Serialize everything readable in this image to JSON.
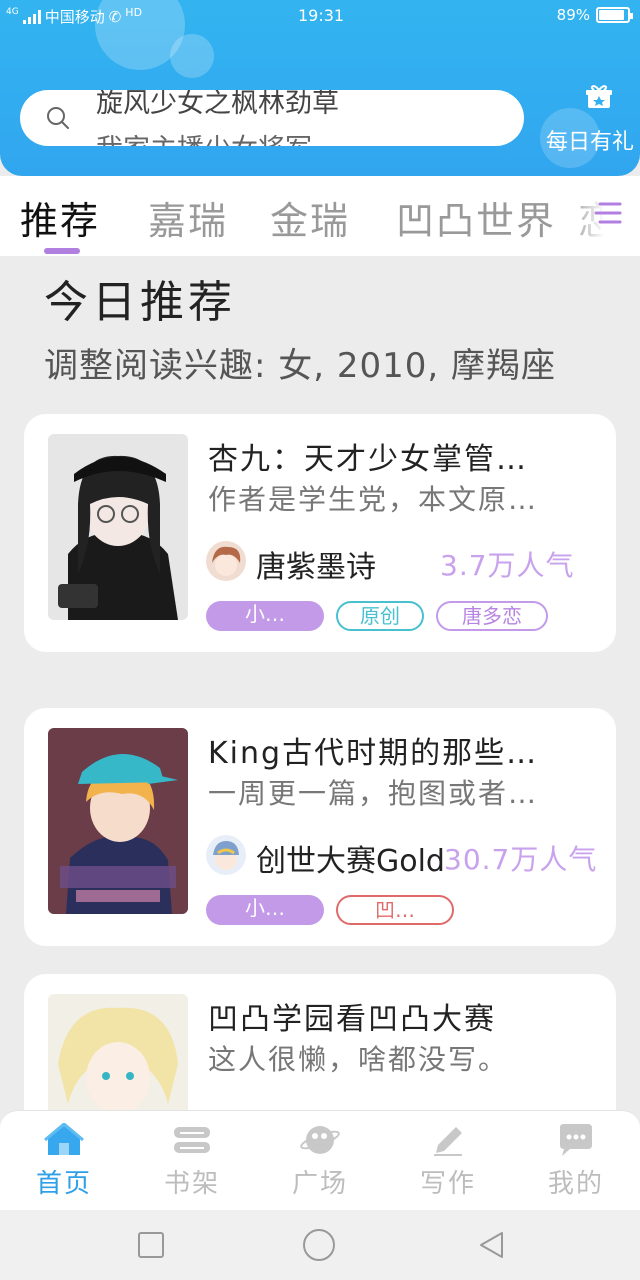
{
  "status_bar": {
    "network": "4G",
    "carrier": "中国移动",
    "hd": "HD",
    "time": "19:31",
    "battery_text": "89%",
    "battery_level": 0.89
  },
  "header": {
    "search_hints": [
      "旋风少女之枫林劲草",
      "我家主播少女将军"
    ],
    "gift_label": "每日有礼",
    "accent_color": "#33b4f0"
  },
  "tabs": [
    {
      "label": "推荐",
      "active": true
    },
    {
      "label": "嘉瑞",
      "active": false
    },
    {
      "label": "金瑞",
      "active": false
    },
    {
      "label": "凹凸世界",
      "active": false
    },
    {
      "label": "恋",
      "active": false
    }
  ],
  "section": {
    "title": "今日推荐",
    "subtitle": "调整阅读兴趣: 女, 2010, 摩羯座"
  },
  "books": [
    {
      "title": "杏九：天才少女掌管…",
      "desc": "作者是学生党，本文原…",
      "author": "唐紫墨诗",
      "popularity": "3.7万人气",
      "tags": [
        {
          "label": "小…",
          "style": "filled"
        },
        {
          "label": "原创",
          "style": "teal"
        },
        {
          "label": "唐多恋",
          "style": "purple"
        }
      ]
    },
    {
      "title": "King古代时期的那些…",
      "desc": "一周更一篇，抱图或者…",
      "author": "创世大赛Gold",
      "popularity": "30.7万人气",
      "tags": [
        {
          "label": "小…",
          "style": "filled"
        },
        {
          "label": "凹…",
          "style": "red"
        }
      ]
    },
    {
      "title": "凹凸学园看凹凸大赛",
      "desc": "这人很懒，啥都没写。",
      "author": "",
      "popularity": "",
      "tags": []
    }
  ],
  "bottom_nav": [
    {
      "label": "首页",
      "icon": "home-icon",
      "active": true
    },
    {
      "label": "书架",
      "icon": "bookshelf-icon",
      "active": false
    },
    {
      "label": "广场",
      "icon": "planet-icon",
      "active": false
    },
    {
      "label": "写作",
      "icon": "pen-icon",
      "active": false
    },
    {
      "label": "我的",
      "icon": "chat-bubble-icon",
      "active": false
    }
  ]
}
